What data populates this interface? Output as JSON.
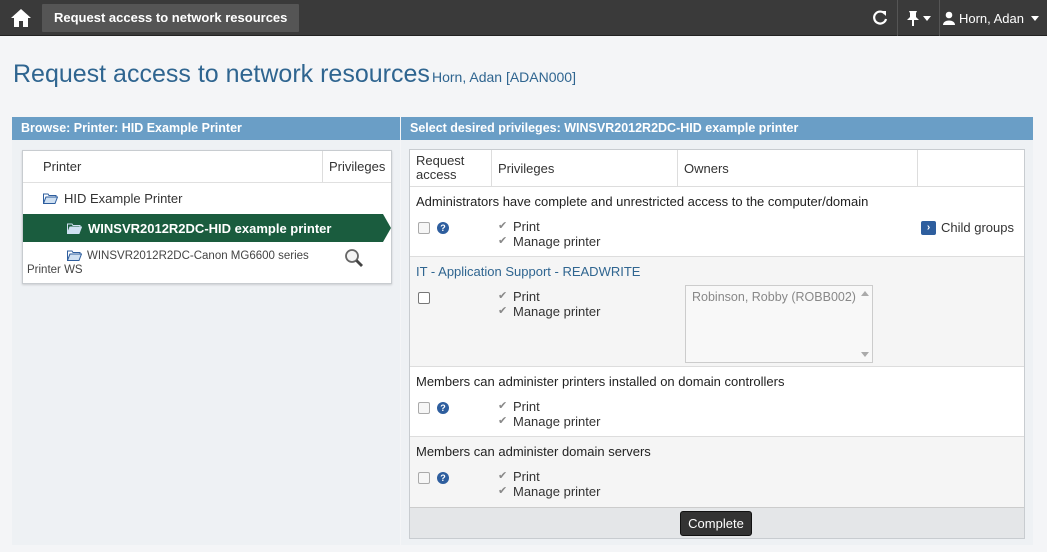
{
  "topbar": {
    "tab_label": "Request access to network resources",
    "user_name": "Horn, Adan",
    "icons": [
      "home-icon",
      "refresh-icon",
      "pin-icon",
      "user-icon"
    ]
  },
  "page": {
    "title": "Request access to network resources",
    "subtitle": "Horn, Adan [ADAN000]"
  },
  "browse": {
    "header": "Browse: Printer: HID Example Printer",
    "col_printer": "Printer",
    "col_privileges": "Privileges",
    "root": "HID Example Printer",
    "selected": "WINSVR2012R2DC-HID example printer",
    "other": "WINSVR2012R2DC-Canon MG6600 series Printer WS"
  },
  "privileges": {
    "header": "Select desired privileges: WINSVR2012R2DC-HID example printer",
    "col_request": "Request access",
    "col_privileges": "Privileges",
    "col_owners": "Owners",
    "groups": [
      {
        "title": "Administrators have complete and unrestricted access to the computer/domain",
        "privs": [
          "Print",
          "Manage printer"
        ],
        "child_groups": "Child groups"
      },
      {
        "title": "IT - Application Support - READWRITE",
        "privs": [
          "Print",
          "Manage printer"
        ],
        "owner": "Robinson, Robby (ROBB002)"
      },
      {
        "title": "Members can administer printers installed on domain controllers",
        "privs": [
          "Print",
          "Manage printer"
        ]
      },
      {
        "title": "Members can administer domain servers",
        "privs": [
          "Print",
          "Manage printer"
        ]
      }
    ],
    "complete_label": "Complete"
  },
  "colors": {
    "topbar": "#3a3a3a",
    "panel_header": "#6a9ec6",
    "selected_row": "#1a5c3e",
    "title": "#2f6590"
  }
}
